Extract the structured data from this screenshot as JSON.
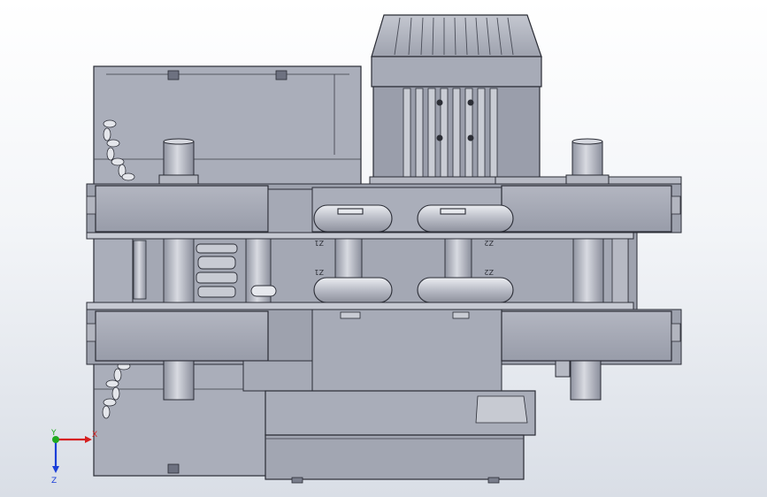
{
  "triad": {
    "x_label": "X",
    "y_label": "Y",
    "z_label": "Z"
  },
  "gear_marks": {
    "top_left": "Z1",
    "top_right": "Z2",
    "bottom_left": "Z1",
    "bottom_right": "Z2"
  },
  "colors": {
    "background_top": "#ffffff",
    "background_bottom": "#d9dee6",
    "part_fill": "#a9adb9",
    "part_light": "#c6c9d2",
    "part_dark": "#7c8090",
    "edge": "#2a2c35",
    "triad_x": "#d62020",
    "triad_y": "#1faa1f",
    "triad_z": "#1b3fd8"
  }
}
